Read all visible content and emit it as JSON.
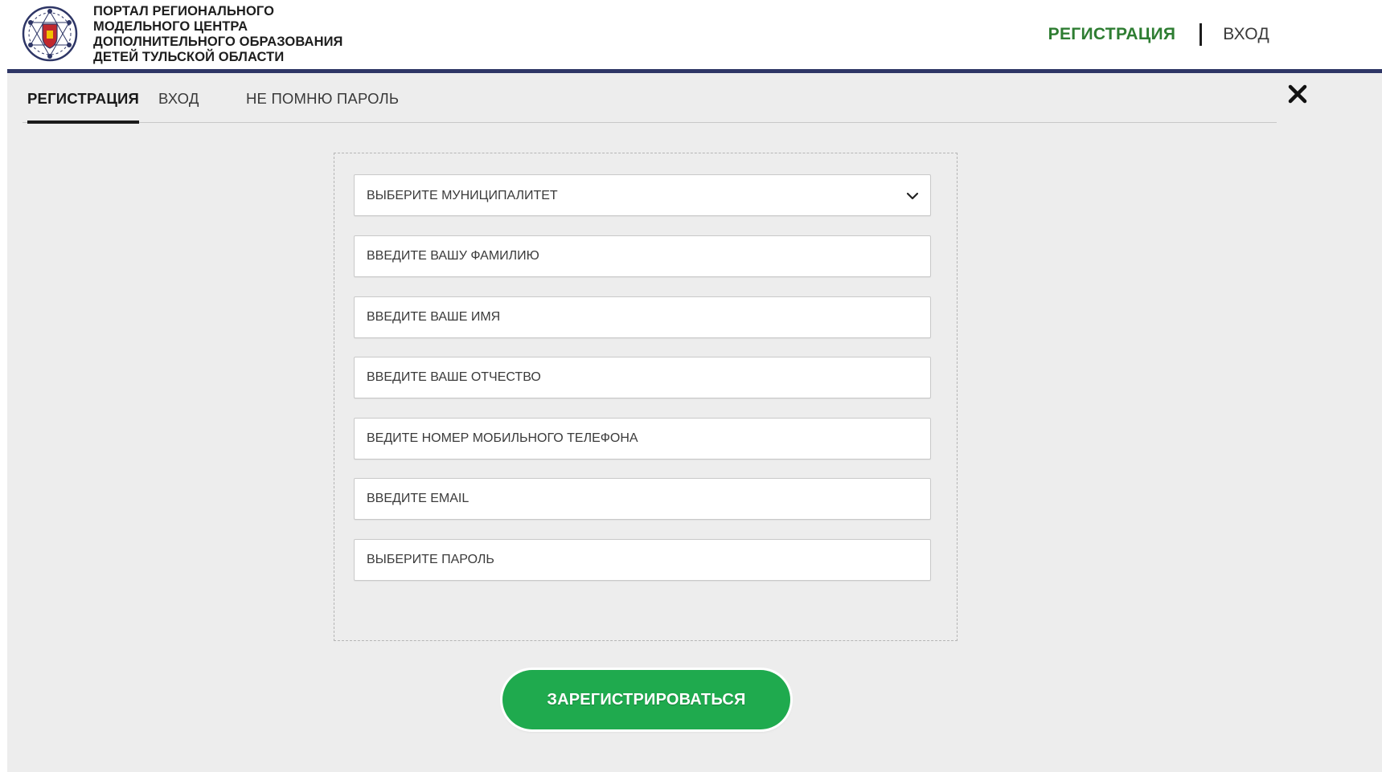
{
  "header": {
    "logo_icon": "regional-center-emblem-icon",
    "title_lines": [
      "ПОРТАЛ РЕГИОНАЛЬНОГО",
      "МОДЕЛЬНОГО ЦЕНТРА",
      "ДОПОЛНИТЕЛЬНОГО ОБРАЗОВАНИЯ",
      "ДЕТЕЙ ТУЛЬСКОЙ ОБЛАСТИ"
    ],
    "nav": {
      "register_label": "РЕГИСТРАЦИЯ",
      "login_label": "ВХОД"
    },
    "accent_color": "#2e7d32",
    "bar_color": "#2e3666"
  },
  "modal": {
    "tabs": [
      {
        "label": "РЕГИСТРАЦИЯ",
        "active": true
      },
      {
        "label": "ВХОД",
        "active": false
      },
      {
        "label": "НЕ ПОМНЮ ПАРОЛЬ",
        "active": false
      }
    ],
    "close_icon": "close-icon",
    "form": {
      "municipality_select": {
        "value": "ВЫБЕРИТЕ МУНИЦИПАЛИТЕТ",
        "icon": "chevron-down-icon"
      },
      "last_name_placeholder": "ВВЕДИТЕ ВАШУ ФАМИЛИЮ",
      "first_name_placeholder": "ВВЕДИТЕ ВАШЕ ИМЯ",
      "patronymic_placeholder": "ВВЕДИТЕ ВАШЕ ОТЧЕСТВО",
      "phone_placeholder": "ВЕДИТЕ НОМЕР МОБИЛЬНОГО ТЕЛЕФОНА",
      "email_placeholder": "ВВЕДИТЕ EMAIL",
      "password_placeholder": "ВЫБЕРИТЕ ПАРОЛЬ"
    },
    "submit_label": "ЗАРЕГИСТРИРОВАТЬСЯ",
    "submit_color": "#1faa4e"
  }
}
